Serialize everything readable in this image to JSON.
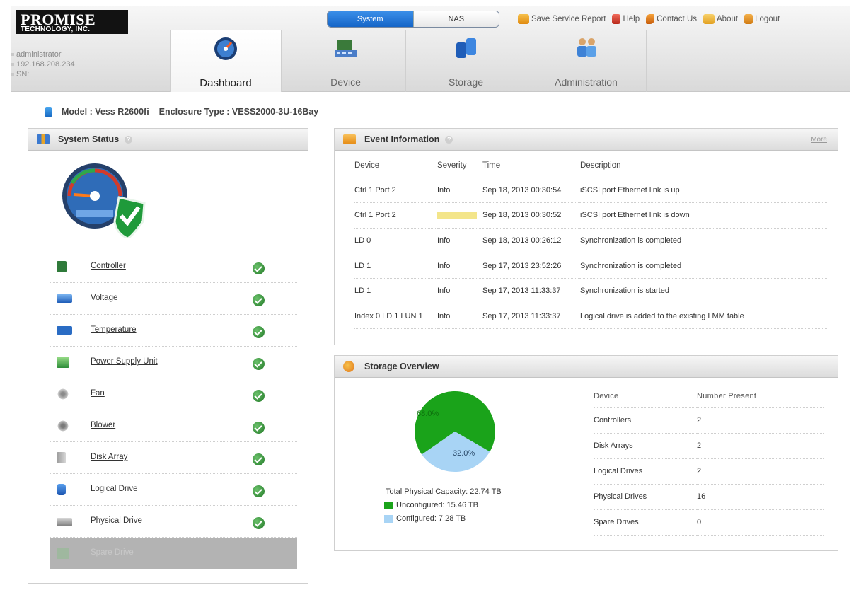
{
  "brand": {
    "line1": "PROMISE",
    "line2": "TECHNOLOGY, INC."
  },
  "user": {
    "name": "administrator",
    "ip": "192.168.208.234",
    "sn": "SN:"
  },
  "mode_switch": {
    "active": "System",
    "inactive": "NAS"
  },
  "top_links": [
    "Save Service Report",
    "Help",
    "Contact Us",
    "About",
    "Logout"
  ],
  "tabs": [
    "Dashboard",
    "Device",
    "Storage",
    "Administration"
  ],
  "model_bar": {
    "model": "Model : Vess R2600fi",
    "enclosure": "Enclosure Type : VESS2000-3U-16Bay"
  },
  "system_status": {
    "title": "System Status",
    "items": [
      "Controller",
      "Voltage",
      "Temperature",
      "Power Supply Unit",
      "Fan",
      "Blower",
      "Disk Array",
      "Logical Drive",
      "Physical Drive",
      "Spare Drive"
    ]
  },
  "event_info": {
    "title": "Event Information",
    "more": "More",
    "headers": [
      "Device",
      "Severity",
      "Time",
      "Description"
    ],
    "rows": [
      [
        "Ctrl 1 Port 2",
        "Info",
        "Sep 18, 2013 00:30:54",
        "iSCSI port Ethernet link is up"
      ],
      [
        "Ctrl 1 Port 2",
        "",
        "Sep 18, 2013 00:30:52",
        "iSCSI port Ethernet link is down"
      ],
      [
        "LD 0",
        "Info",
        "Sep 18, 2013 00:26:12",
        "Synchronization is completed"
      ],
      [
        "LD 1",
        "Info",
        "Sep 17, 2013 23:52:26",
        "Synchronization is completed"
      ],
      [
        "LD 1",
        "Info",
        "Sep 17, 2013 11:33:37",
        "Synchronization is started"
      ],
      [
        "Index 0 LD 1 LUN 1",
        "Info",
        "Sep 17, 2013 11:33:37",
        "Logical drive is added to the existing LMM table"
      ]
    ]
  },
  "storage_overview": {
    "title": "Storage Overview",
    "pie": {
      "unconfigured_pct": "68.0%",
      "configured_pct": "32.0%",
      "unconfigured_value": 68.0,
      "configured_value": 32.0
    },
    "total": "Total Physical Capacity: 22.74 TB",
    "legend_unconfigured": "Unconfigured: 15.46 TB",
    "legend_configured": "Configured: 7.28 TB",
    "headers": [
      "Device",
      "Number Present"
    ],
    "rows": [
      [
        "Controllers",
        "2"
      ],
      [
        "Disk Arrays",
        "2"
      ],
      [
        "Logical Drives",
        "2"
      ],
      [
        "Physical Drives",
        "16"
      ],
      [
        "Spare Drives",
        "0"
      ]
    ]
  },
  "colors": {
    "accent": "#1565c8",
    "status_ok": "#2e8b2e",
    "pie_unconfigured": "#1aa31a",
    "pie_configured": "#a8d4f5"
  }
}
